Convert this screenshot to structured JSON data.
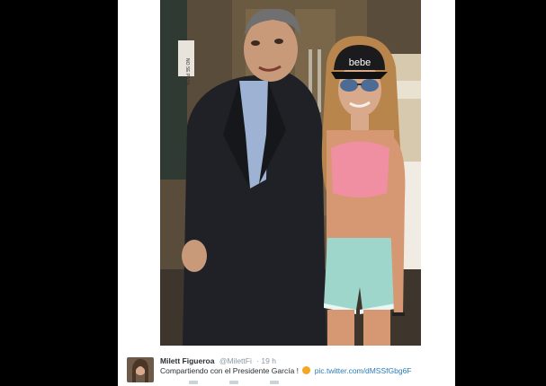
{
  "tweet": {
    "display_name": "Milett Figueroa",
    "handle": "@MilettFi",
    "time": "· 19 h",
    "text": "Compartiendo con el Presidente García !",
    "link": "pic.twitter.com/dMSSfGbg6F",
    "photo_text": {
      "cap_brand": "bebe",
      "door_sign": "NO SE PASA"
    }
  },
  "colors": {
    "link": "#2b7bb9",
    "text": "#292f33",
    "muted": "#8899a6",
    "background": "#000000",
    "card": "#ffffff"
  },
  "icons": [
    "reply-icon",
    "retweet-icon",
    "favorite-icon"
  ]
}
